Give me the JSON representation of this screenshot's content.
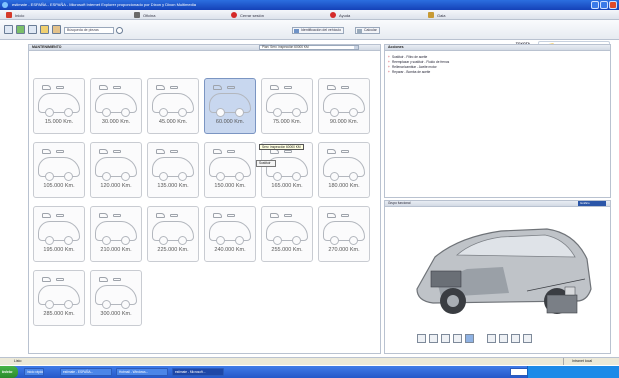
{
  "window": {
    "title": "estimate - ESPAÑA - ESPAÑA - Microsoft Internet Explorer proporcionado por Dixon y Dixon Multimedia"
  },
  "menu": {
    "items": [
      {
        "label": "Inicio",
        "icon": "home-icon"
      },
      {
        "label": "Oficina",
        "icon": "office-icon"
      },
      {
        "label": "Cerrar sesión",
        "icon": "logout-icon"
      },
      {
        "label": "Ayuda",
        "icon": "help-icon"
      },
      {
        "label": "Gaia",
        "icon": "gaia-icon"
      }
    ]
  },
  "toolbar": {
    "search_value": "Búsqueda de piezas",
    "ident_button": "Identificación del vehículo",
    "calc_button": "Calcular",
    "vehicle_make": "TOYOTA",
    "vehicle_model": "COROLLA (E) 1.6P 4D 4AL",
    "logo_text": "estimate"
  },
  "left": {
    "header": "MANTENIMIENTO",
    "plan_value": "Plan: Serv. inspección 60000 KM",
    "tiles": [
      "15.000 Km.",
      "30.000 Km.",
      "45.000 Km.",
      "60.000 Km.",
      "75.000 Km.",
      "90.000 Km.",
      "105.000 Km.",
      "120.000 Km.",
      "135.000 Km.",
      "150.000 Km.",
      "165.000 Km.",
      "180.000 Km.",
      "195.000 Km.",
      "210.000 Km.",
      "225.000 Km.",
      "240.000 Km.",
      "255.000 Km.",
      "270.000 Km.",
      "285.000 Km.",
      "300.000 Km."
    ],
    "selected_index": 3,
    "tooltip": "Serv. inspección 60000 KM",
    "popup_label": "Sustituir"
  },
  "right": {
    "header": "Acciones",
    "tree": [
      "Sustituir - Filtro de aceite",
      "Reemplazar y sustituir - Fluido de frenos",
      "Rellenar/cambiar - Aceite motor",
      "Reparar - Bomba de aceite"
    ]
  },
  "image_panel": {
    "header": "Grupo funcional",
    "tab": "Gráfico"
  },
  "status": {
    "left": "Listo",
    "zone": "Intranet local"
  },
  "taskbar": {
    "start": "Inicio",
    "tasks": [
      "Inicio rápido",
      "estimate - ESPAÑA...",
      "Hotmail - Windows...",
      "estimate - Microsoft..."
    ]
  }
}
